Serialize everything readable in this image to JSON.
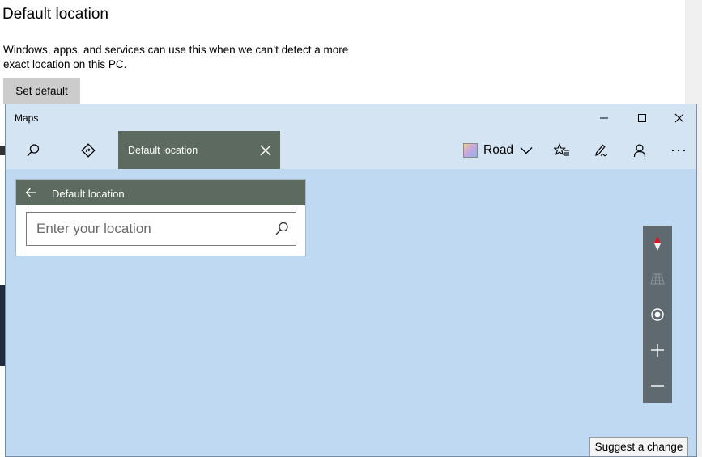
{
  "settings": {
    "title": "Default location",
    "description": "Windows, apps, and services can use this when we can’t detect a more exact location on this PC.",
    "set_default_label": "Set default"
  },
  "maps": {
    "app_title": "Maps",
    "active_tab_label": "Default location",
    "map_style_label": "Road",
    "panel": {
      "title": "Default location",
      "input_value": "",
      "input_placeholder": "Enter your location"
    },
    "suggest_label": "Suggest a change"
  },
  "colors": {
    "accent_tab": "#5c6a5f",
    "map_background": "#bfd9f2",
    "titlebar": "#d5e4f3",
    "controls": "#5e6a70",
    "compass_north": "#e81123"
  },
  "icons": {
    "search": "search-icon",
    "directions": "directions-icon",
    "close_tab": "close-icon",
    "map_style": "road-map-icon",
    "dropdown": "chevron-down-icon",
    "favorites": "favorites-icon",
    "ink": "pen-icon",
    "account": "person-icon",
    "more": "more-icon",
    "back": "back-arrow-icon",
    "compass": "compass-icon",
    "tilt": "tilt-icon",
    "locate": "locate-icon",
    "zoom_in": "zoom-in-icon",
    "zoom_out": "zoom-out-icon"
  }
}
